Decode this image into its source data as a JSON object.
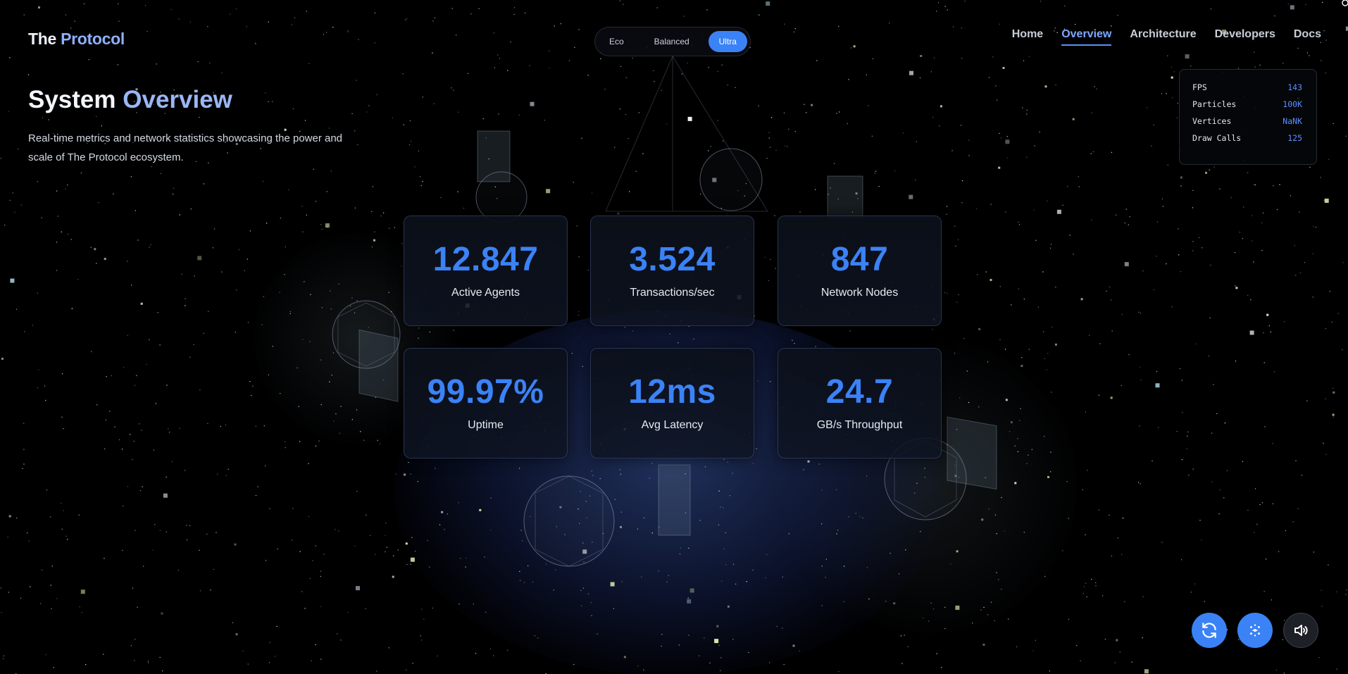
{
  "brand": {
    "logo_part1": "The ",
    "logo_part2": "Protocol"
  },
  "mode_switch": {
    "options": [
      "Eco",
      "Balanced",
      "Ultra"
    ],
    "selected": "Ultra"
  },
  "nav": {
    "items": [
      "Home",
      "Overview",
      "Architecture",
      "Developers",
      "Docs"
    ],
    "active": "Overview"
  },
  "hero": {
    "title_part1": "System ",
    "title_part2": "Overview",
    "subtitle": "Real-time metrics and network statistics showcasing the power and scale of The Protocol ecosystem."
  },
  "perf_panel": {
    "rows": [
      {
        "label": "FPS",
        "value": "143"
      },
      {
        "label": "Particles",
        "value": "100K"
      },
      {
        "label": "Vertices",
        "value": "NaNK"
      },
      {
        "label": "Draw Calls",
        "value": "125"
      }
    ]
  },
  "metrics": [
    {
      "value": "12.847",
      "label": "Active Agents"
    },
    {
      "value": "3.524",
      "label": "Transactions/sec"
    },
    {
      "value": "847",
      "label": "Network Nodes"
    },
    {
      "value": "99.97%",
      "label": "Uptime"
    },
    {
      "value": "12ms",
      "label": "Avg Latency"
    },
    {
      "value": "24.7",
      "label": "GB/s Throughput"
    }
  ],
  "controls": {
    "buttons": [
      {
        "name": "refresh-button",
        "icon": "refresh-icon"
      },
      {
        "name": "particles-button",
        "icon": "particles-icon"
      },
      {
        "name": "sound-button",
        "icon": "speaker-icon"
      }
    ]
  },
  "colors": {
    "accent": "#3b82f6",
    "background": "#000000",
    "accent_light": "#8fb0ff"
  }
}
